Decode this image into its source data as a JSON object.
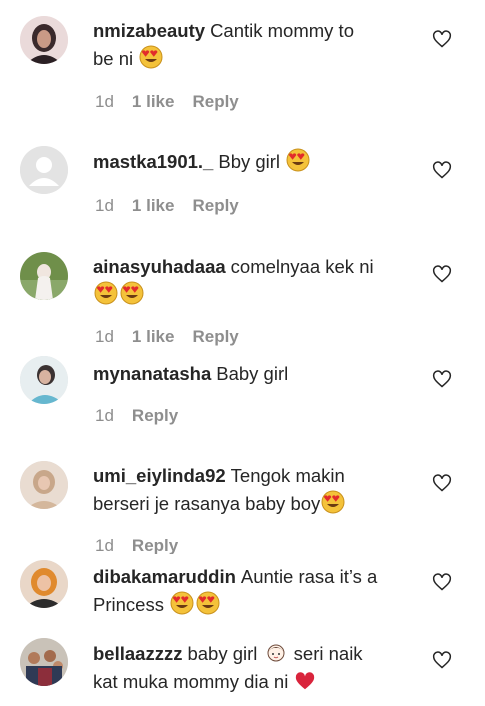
{
  "comments": [
    {
      "username": "nmizabeauty",
      "text_1": "Cantik mommy to",
      "text_2": "be ni",
      "emoji_2": "heart-eyes",
      "time": "1d",
      "likes": "1 like",
      "reply": "Reply",
      "avatar": "woman-hijab-dark"
    },
    {
      "username": "mastka1901._",
      "text_1": "Bby girl",
      "emoji_1": "heart-eyes",
      "time": "1d",
      "likes": "1 like",
      "reply": "Reply",
      "avatar": "default-user"
    },
    {
      "username": "ainasyuhadaaa",
      "text_1": "comelnyaa kek ni",
      "emoji_2": "heart-eyes x2",
      "time": "1d",
      "likes": "1 like",
      "reply": "Reply",
      "avatar": "outdoor-person"
    },
    {
      "username": "mynanatasha",
      "text_1": "Baby girl",
      "time": "1d",
      "reply": "Reply",
      "avatar": "person-blue"
    },
    {
      "username": "umi_eiylinda92",
      "text_1": "Tengok makin",
      "text_2": "berseri je rasanya baby boy",
      "emoji_2": "heart-eyes",
      "time": "1d",
      "reply": "Reply",
      "avatar": "woman-hijab-light"
    },
    {
      "username": "dibakamaruddin",
      "text_1": "Auntie rasa it’s a",
      "text_2": "Princess",
      "emoji_2": "heart-eyes x2",
      "avatar": "woman-hijab-orange"
    },
    {
      "username": "bellaazzzz",
      "text_1": "baby girl",
      "text_1b": "seri naik",
      "text_2": "kat muka mommy dia ni",
      "emoji_1": "baby-girl",
      "emoji_2": "red-heart",
      "avatar": "group-photo"
    }
  ]
}
